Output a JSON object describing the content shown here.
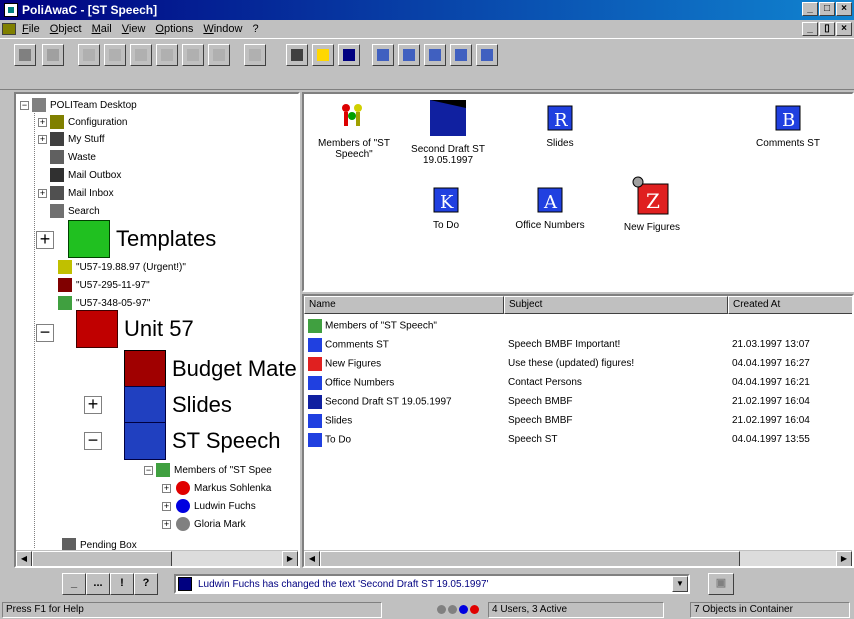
{
  "window": {
    "title": "PoliAwaC - [ST Speech]"
  },
  "titlebar_buttons": [
    "_",
    "□",
    "×"
  ],
  "mdi_buttons": [
    "_",
    "▯",
    "×"
  ],
  "menu": [
    "File",
    "Object",
    "Mail",
    "View",
    "Options",
    "Window",
    "?"
  ],
  "tree": {
    "root": "POLITeam Desktop",
    "items": [
      "Configuration",
      "My Stuff",
      "Waste",
      "Mail Outbox",
      "Mail Inbox",
      "Search"
    ],
    "templates": "Templates",
    "files": [
      "\"U57-19.88.97 (Urgent!)\"",
      "\"U57-295-11-97\"",
      "\"U57-348-05-97\""
    ],
    "unit": "Unit 57",
    "budget": "Budget Mate",
    "slides": "Slides",
    "speech": "ST Speech",
    "members_label": "Members of \"ST Spee",
    "members": [
      "Markus Sohlenka",
      "Ludwin Fuchs",
      "Gloria Mark"
    ],
    "pending": "Pending Box"
  },
  "icons": [
    {
      "label": "Members of \"ST Speech\"",
      "kind": "members"
    },
    {
      "label": "Second Draft ST 19.05.1997",
      "kind": "doc-dark"
    },
    {
      "label": "Slides",
      "kind": "doc-r"
    },
    {
      "label": "Comments ST",
      "kind": "doc-b"
    },
    {
      "label": "To Do",
      "kind": "doc-k"
    },
    {
      "label": "Office Numbers",
      "kind": "doc-a"
    },
    {
      "label": "New Figures",
      "kind": "doc-red"
    }
  ],
  "list": {
    "columns": [
      "Name",
      "Subject",
      "Created At"
    ],
    "rows": [
      {
        "name": "Members of \"ST Speech\"",
        "subject": "",
        "created": ""
      },
      {
        "name": "Comments ST",
        "subject": "Speech BMBF Important!",
        "created": "21.03.1997 13:07"
      },
      {
        "name": "New Figures",
        "subject": "Use these (updated) figures!",
        "created": "04.04.1997 16:27"
      },
      {
        "name": "Office Numbers",
        "subject": "Contact Persons",
        "created": "04.04.1997 16:21"
      },
      {
        "name": "Second Draft ST 19.05.1997",
        "subject": "Speech BMBF",
        "created": "21.02.1997 16:04"
      },
      {
        "name": "Slides",
        "subject": "Speech BMBF",
        "created": "21.02.1997 16:04"
      },
      {
        "name": "To Do",
        "subject": "Speech ST",
        "created": "04.04.1997 13:55"
      }
    ]
  },
  "actions": [
    "_",
    "...",
    "!",
    "?"
  ],
  "message": "Ludwin Fuchs has changed the text 'Second Draft ST 19.05.1997'",
  "status": {
    "help": "Press F1 for Help",
    "users": "4 Users, 3 Active",
    "objects": "7 Objects in Container"
  },
  "colors": {
    "title_start": "#000080",
    "title_end": "#1084d0",
    "face": "#c0c0c0"
  }
}
